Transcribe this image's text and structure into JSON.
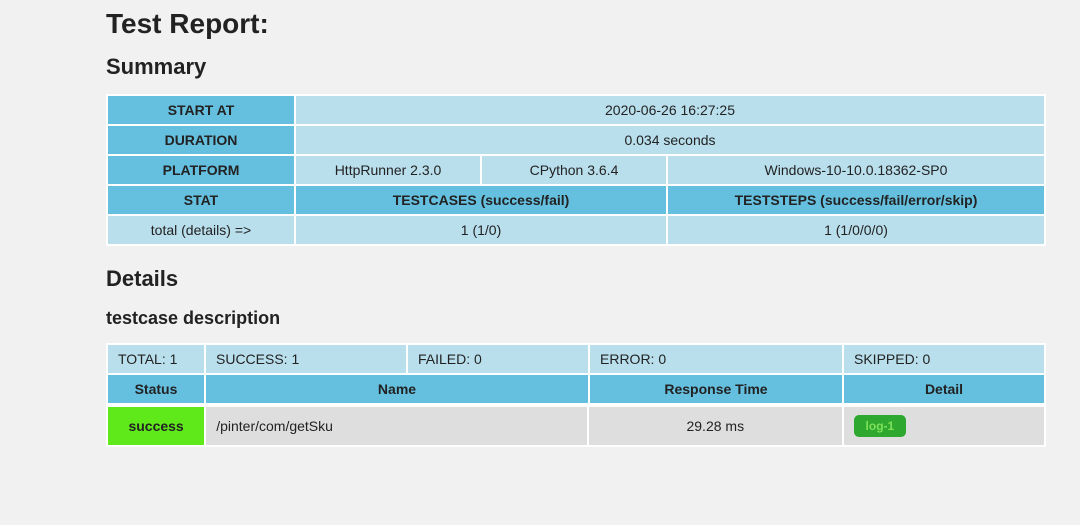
{
  "title": "Test Report:",
  "sections": {
    "summary": "Summary",
    "details": "Details",
    "testcase_desc": "testcase description"
  },
  "summary": {
    "labels": {
      "start_at": "START AT",
      "duration": "DURATION",
      "platform": "PLATFORM",
      "stat": "STAT",
      "stat_row_label": "total (details) =>"
    },
    "start_at": "2020-06-26 16:27:25",
    "duration": "0.034 seconds",
    "platform": {
      "runner": "HttpRunner 2.3.0",
      "python": "CPython 3.6.4",
      "os": "Windows-10-10.0.18362-SP0"
    },
    "stat_headers": {
      "testcases": "TESTCASES (success/fail)",
      "teststeps": "TESTSTEPS (success/fail/error/skip)"
    },
    "stat_values": {
      "testcases": "1 (1/0)",
      "teststeps": "1 (1/0/0/0)"
    }
  },
  "details": {
    "counts": {
      "total": "TOTAL: 1",
      "success": "SUCCESS: 1",
      "failed": "FAILED: 0",
      "error": "ERROR: 0",
      "skipped": "SKIPPED: 0"
    },
    "headers": {
      "status": "Status",
      "name": "Name",
      "response_time": "Response Time",
      "detail": "Detail"
    },
    "rows": [
      {
        "status": "success",
        "name": "/pinter/com/getSku",
        "response_time": "29.28 ms",
        "log_label": "log-1"
      }
    ]
  }
}
